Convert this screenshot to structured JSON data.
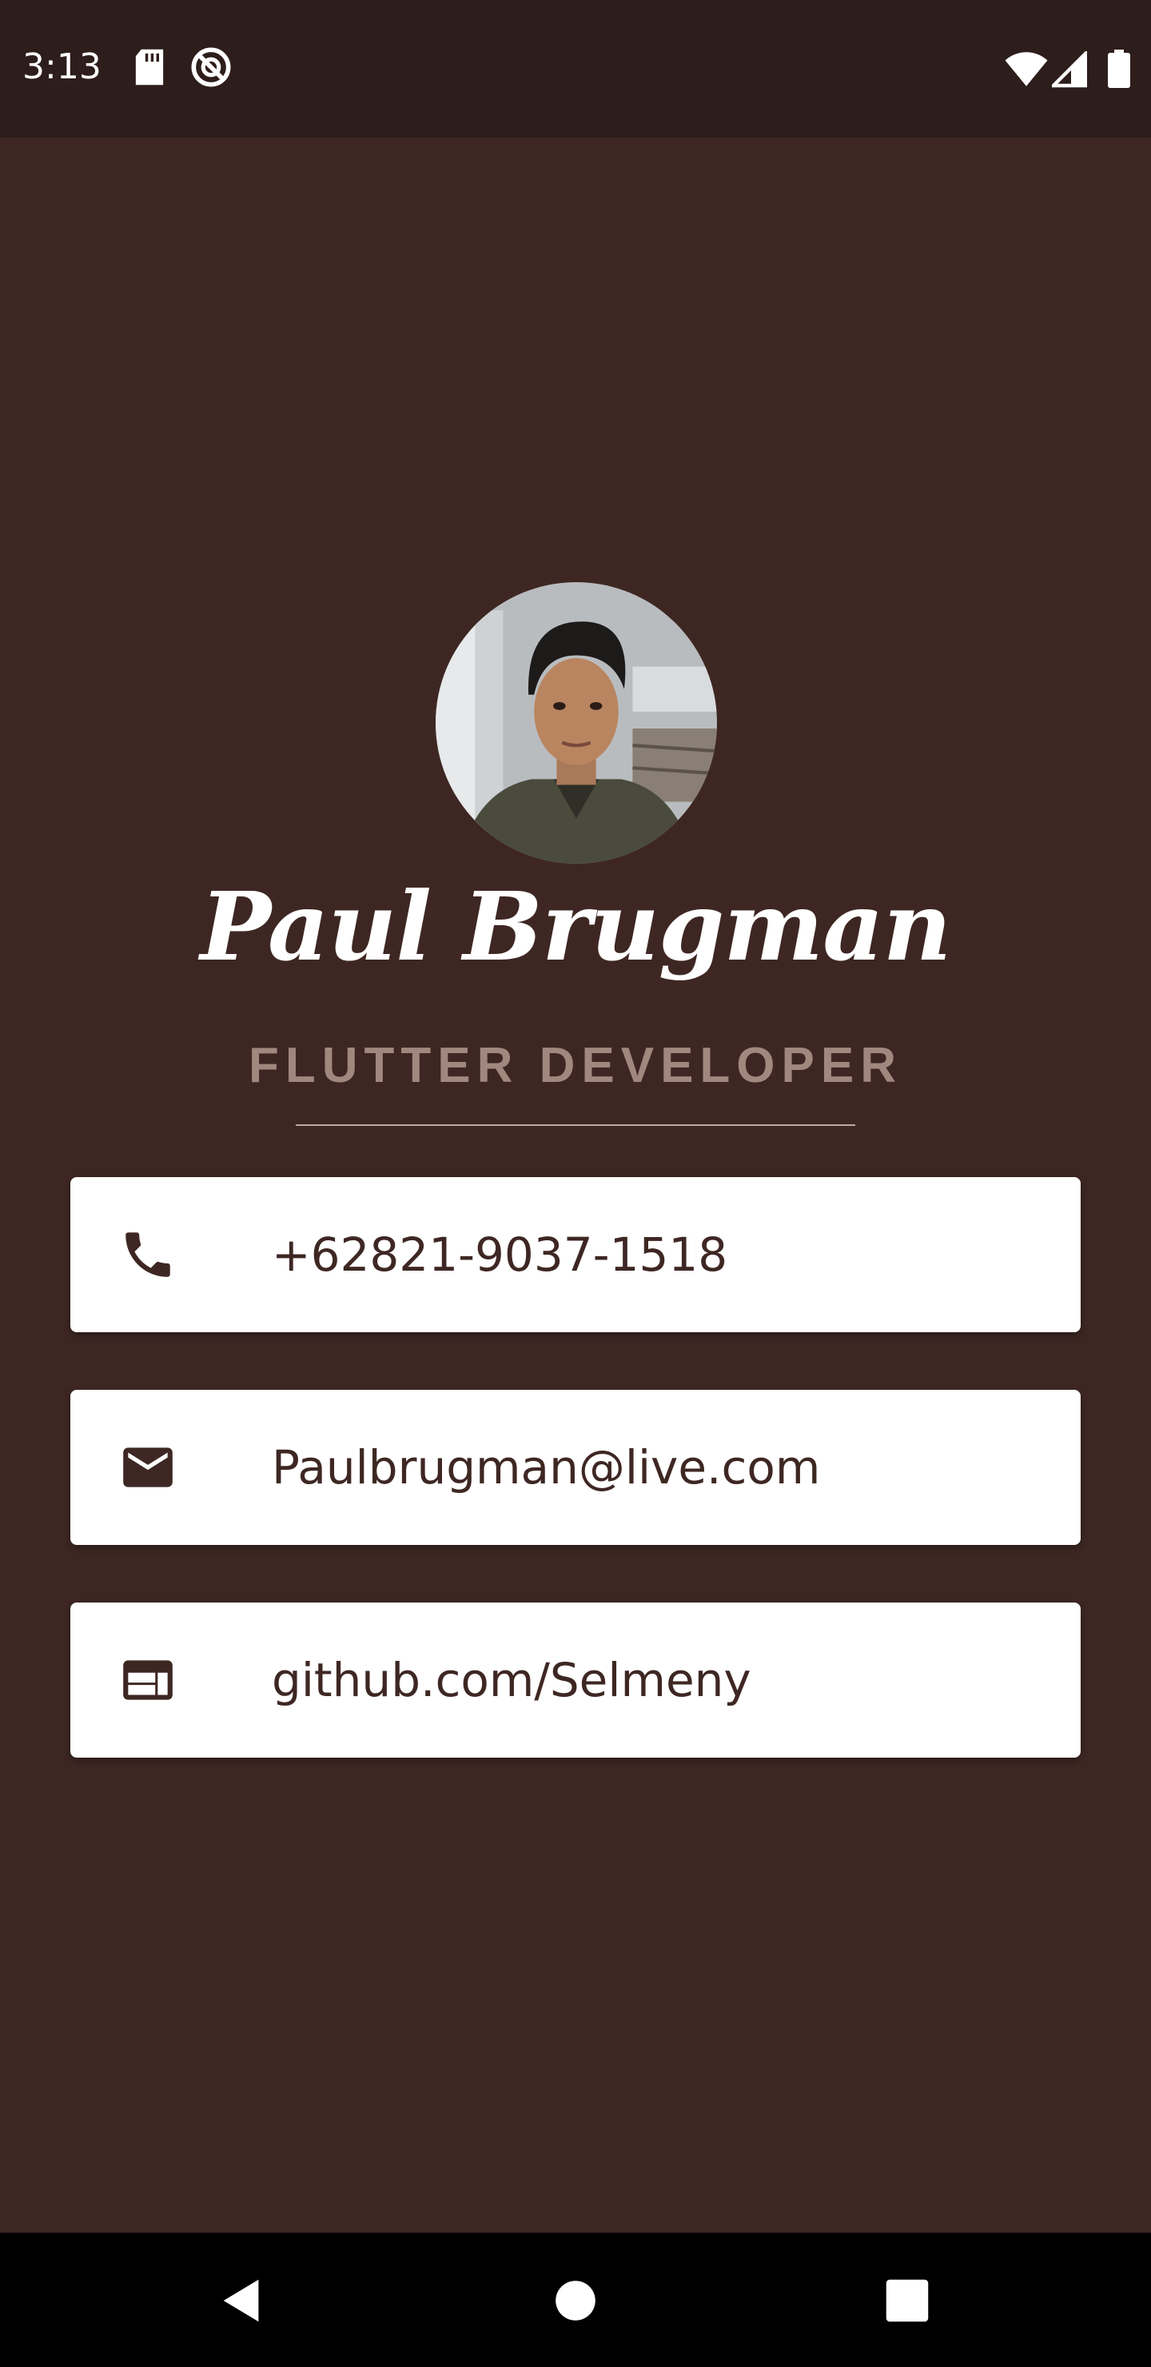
{
  "status_bar": {
    "time": "3:13",
    "icons": [
      "sd-card-icon",
      "do-not-disturb-icon",
      "wifi-icon",
      "signal-icon",
      "battery-icon"
    ]
  },
  "profile": {
    "name": "Paul Brugman",
    "title": "FLUTTER DEVELOPER"
  },
  "contacts": [
    {
      "icon": "phone-icon",
      "text": "+62821-9037-1518"
    },
    {
      "icon": "mail-icon",
      "text": "Paulbrugman@live.com"
    },
    {
      "icon": "web-icon",
      "text": "github.com/Selmeny"
    }
  ],
  "nav": [
    "back-button",
    "home-button",
    "recents-button"
  ],
  "colors": {
    "background": "#3e2723",
    "status_bar": "#2d1d1b",
    "card": "#ffffff",
    "card_text": "#3e2723",
    "title": "#a1887f"
  }
}
